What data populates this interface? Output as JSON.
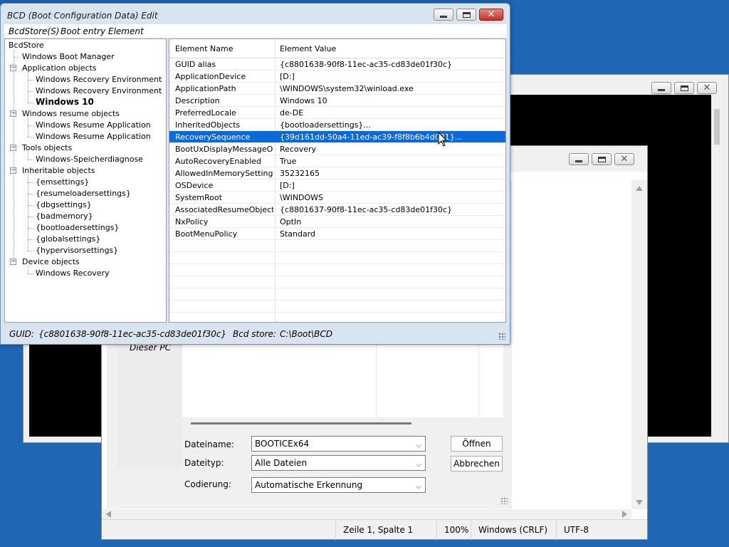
{
  "bcd_window": {
    "title": "BCD (Boot Configuration Data) Edit",
    "menu": [
      "BcdStore(S)",
      "Boot entry",
      "Element"
    ],
    "tree": [
      {
        "label": "BcdStore",
        "level": 0
      },
      {
        "label": "Windows Boot Manager",
        "level": 1
      },
      {
        "label": "Application objects",
        "level": 1,
        "expanded": true
      },
      {
        "label": "Windows Recovery Environment",
        "level": 2
      },
      {
        "label": "Windows Recovery Environment",
        "level": 2
      },
      {
        "label": "Windows 10",
        "level": 2,
        "selected": true
      },
      {
        "label": "Windows resume objects",
        "level": 1,
        "expanded": true
      },
      {
        "label": "Windows Resume Application",
        "level": 2
      },
      {
        "label": "Windows Resume Application",
        "level": 2
      },
      {
        "label": "Tools objects",
        "level": 1,
        "expanded": true
      },
      {
        "label": "Windows-Speicherdiagnose",
        "level": 2
      },
      {
        "label": "Inheritable objects",
        "level": 1,
        "expanded": true
      },
      {
        "label": "{emsettings}",
        "level": 2
      },
      {
        "label": "{resumeloadersettings}",
        "level": 2
      },
      {
        "label": "{dbgsettings}",
        "level": 2
      },
      {
        "label": "{badmemory}",
        "level": 2
      },
      {
        "label": "{bootloadersettings}",
        "level": 2
      },
      {
        "label": "{globalsettings}",
        "level": 2
      },
      {
        "label": "{hypervisorsettings}",
        "level": 2
      },
      {
        "label": "Device objects",
        "level": 1,
        "expanded": true
      },
      {
        "label": "Windows Recovery",
        "level": 2
      }
    ],
    "grid": {
      "col_name": "Element Name",
      "col_value": "Element Value",
      "rows": [
        {
          "name": "GUID alias",
          "value": "{c8801638-90f8-11ec-ac35-cd83de01f30c}"
        },
        {
          "name": "ApplicationDevice",
          "value": "[D:]"
        },
        {
          "name": "ApplicationPath",
          "value": "\\WINDOWS\\system32\\winload.exe"
        },
        {
          "name": "Description",
          "value": "Windows 10"
        },
        {
          "name": "PreferredLocale",
          "value": "de-DE"
        },
        {
          "name": "InheritedObjects",
          "value": "{bootloadersettings}..."
        },
        {
          "name": "RecoverySequence",
          "value": "{39d161dd-50a4-11ed-ac39-f8f8b6b4d081}...",
          "selected": true
        },
        {
          "name": "BootUxDisplayMessageOv...",
          "value": "Recovery"
        },
        {
          "name": "AutoRecoveryEnabled",
          "value": "True"
        },
        {
          "name": "AllowedInMemorySettings",
          "value": "35232165"
        },
        {
          "name": "OSDevice",
          "value": "[D:]"
        },
        {
          "name": "SystemRoot",
          "value": "\\WINDOWS"
        },
        {
          "name": "AssociatedResumeObject",
          "value": "{c8801637-90f8-11ec-ac35-cd83de01f30c}"
        },
        {
          "name": "NxPolicy",
          "value": "OptIn"
        },
        {
          "name": "BootMenuPolicy",
          "value": "Standard"
        }
      ]
    },
    "status": {
      "guid_label": "GUID:",
      "guid_value": "{c8801638-90f8-11ec-ac35-cd83de01f30c}",
      "store_label": "Bcd store:",
      "store_value": "C:\\Boot\\BCD"
    }
  },
  "open_dialog": {
    "nav_item": "Dieser PC",
    "filename_label": "Dateiname:",
    "filename_value": "BOOTICEx64",
    "filetype_label": "Dateityp:",
    "filetype_value": "Alle Dateien",
    "encoding_label": "Codierung:",
    "encoding_value": "Automatische Erkennung",
    "open_button": "Öffnen",
    "cancel_button": "Abbrechen"
  },
  "notepad": {
    "status_position": "Zeile 1, Spalte 1",
    "status_zoom": "100%",
    "status_lineend": "Windows (CRLF)",
    "status_encoding": "UTF-8"
  },
  "colors": {
    "desktop": "#1f66b5",
    "selection": "#0c6ad8",
    "close_button": "#c1321f"
  }
}
